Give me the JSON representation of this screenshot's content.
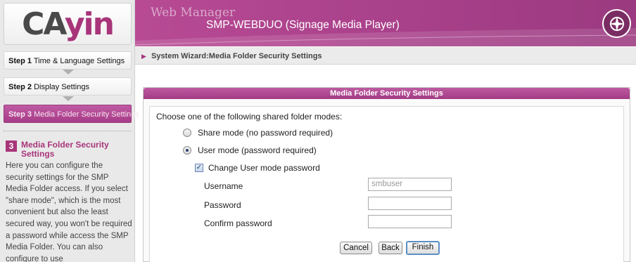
{
  "logo": {
    "text_main": "CA",
    "text_accent": "yin"
  },
  "steps": [
    {
      "num": "Step 1",
      "label": "Time & Language Settings"
    },
    {
      "num": "Step 2",
      "label": "Display Settings"
    },
    {
      "num": "Step 3",
      "label": "Media Folder Security Settings"
    }
  ],
  "active_step_index": 2,
  "help": {
    "badge": "3",
    "title": "Media Folder Security Settings",
    "body": "Here you can configure the security settings for the SMP Media Folder access. If you select \"share mode\", which is the most convenient but also the least secured way, you won't be required a password while access the SMP Media Folder. You can also configure to use"
  },
  "header": {
    "app_name": "Web Manager",
    "device_title": "SMP-WEBDUO (Signage Media Player)"
  },
  "breadcrumb": {
    "text": "System Wizard:Media Folder Security Settings"
  },
  "panel": {
    "title": "Media Folder Security Settings",
    "prompt": "Choose one of the following shared folder modes:",
    "share_mode_label": "Share mode (no password required)",
    "user_mode_label": "User mode (password required)",
    "selected_mode": "user",
    "change_password_label": "Change User mode password",
    "change_password_checked": true,
    "username_label": "Username",
    "username_value": "smbuser",
    "password_label": "Password",
    "password_value": "",
    "confirm_label": "Confirm password",
    "confirm_value": ""
  },
  "buttons": {
    "cancel": "Cancel",
    "back": "Back",
    "finish": "Finish"
  },
  "colors": {
    "brand": "#a8357a",
    "panel_header": "#b04a92",
    "focus_border": "#5a8fc8"
  }
}
